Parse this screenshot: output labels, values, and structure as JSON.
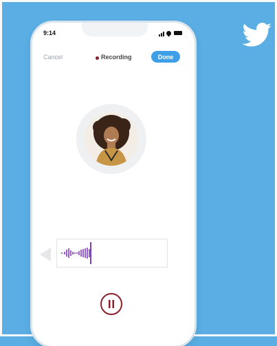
{
  "status_bar": {
    "time": "9:14"
  },
  "header": {
    "cancel_label": "Cancel",
    "recording_label": "Recording",
    "done_label": "Done"
  },
  "colors": {
    "background": "#5aaee3",
    "done_button": "#3f9fe6",
    "recording_accent": "#8b1e2b",
    "waveform": "#9b5fd1"
  },
  "icons": {
    "brand": "twitter-bird-icon",
    "rewind": "triangle-left-icon",
    "control": "pause-icon"
  }
}
